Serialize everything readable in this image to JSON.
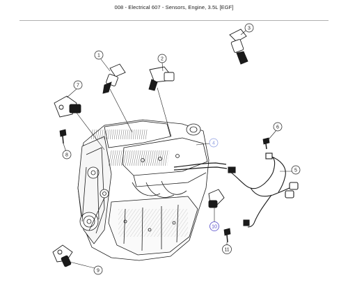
{
  "title": "008 - Electrical 607 - Sensors, Engine, 3.5L [EGF]",
  "colors": {
    "line": "#1a1a1a",
    "callout_highlight": "#4f46c8",
    "callout_highlight_stroke": "#8a9ae0"
  },
  "callouts": [
    {
      "id": "1",
      "label": "1"
    },
    {
      "id": "2",
      "label": "2"
    },
    {
      "id": "3",
      "label": "3"
    },
    {
      "id": "4",
      "label": "4"
    },
    {
      "id": "5",
      "label": "5"
    },
    {
      "id": "6",
      "label": "6"
    },
    {
      "id": "7",
      "label": "7"
    },
    {
      "id": "8",
      "label": "8"
    },
    {
      "id": "9",
      "label": "9"
    },
    {
      "id": "10",
      "label": "10"
    },
    {
      "id": "11",
      "label": "11"
    }
  ]
}
